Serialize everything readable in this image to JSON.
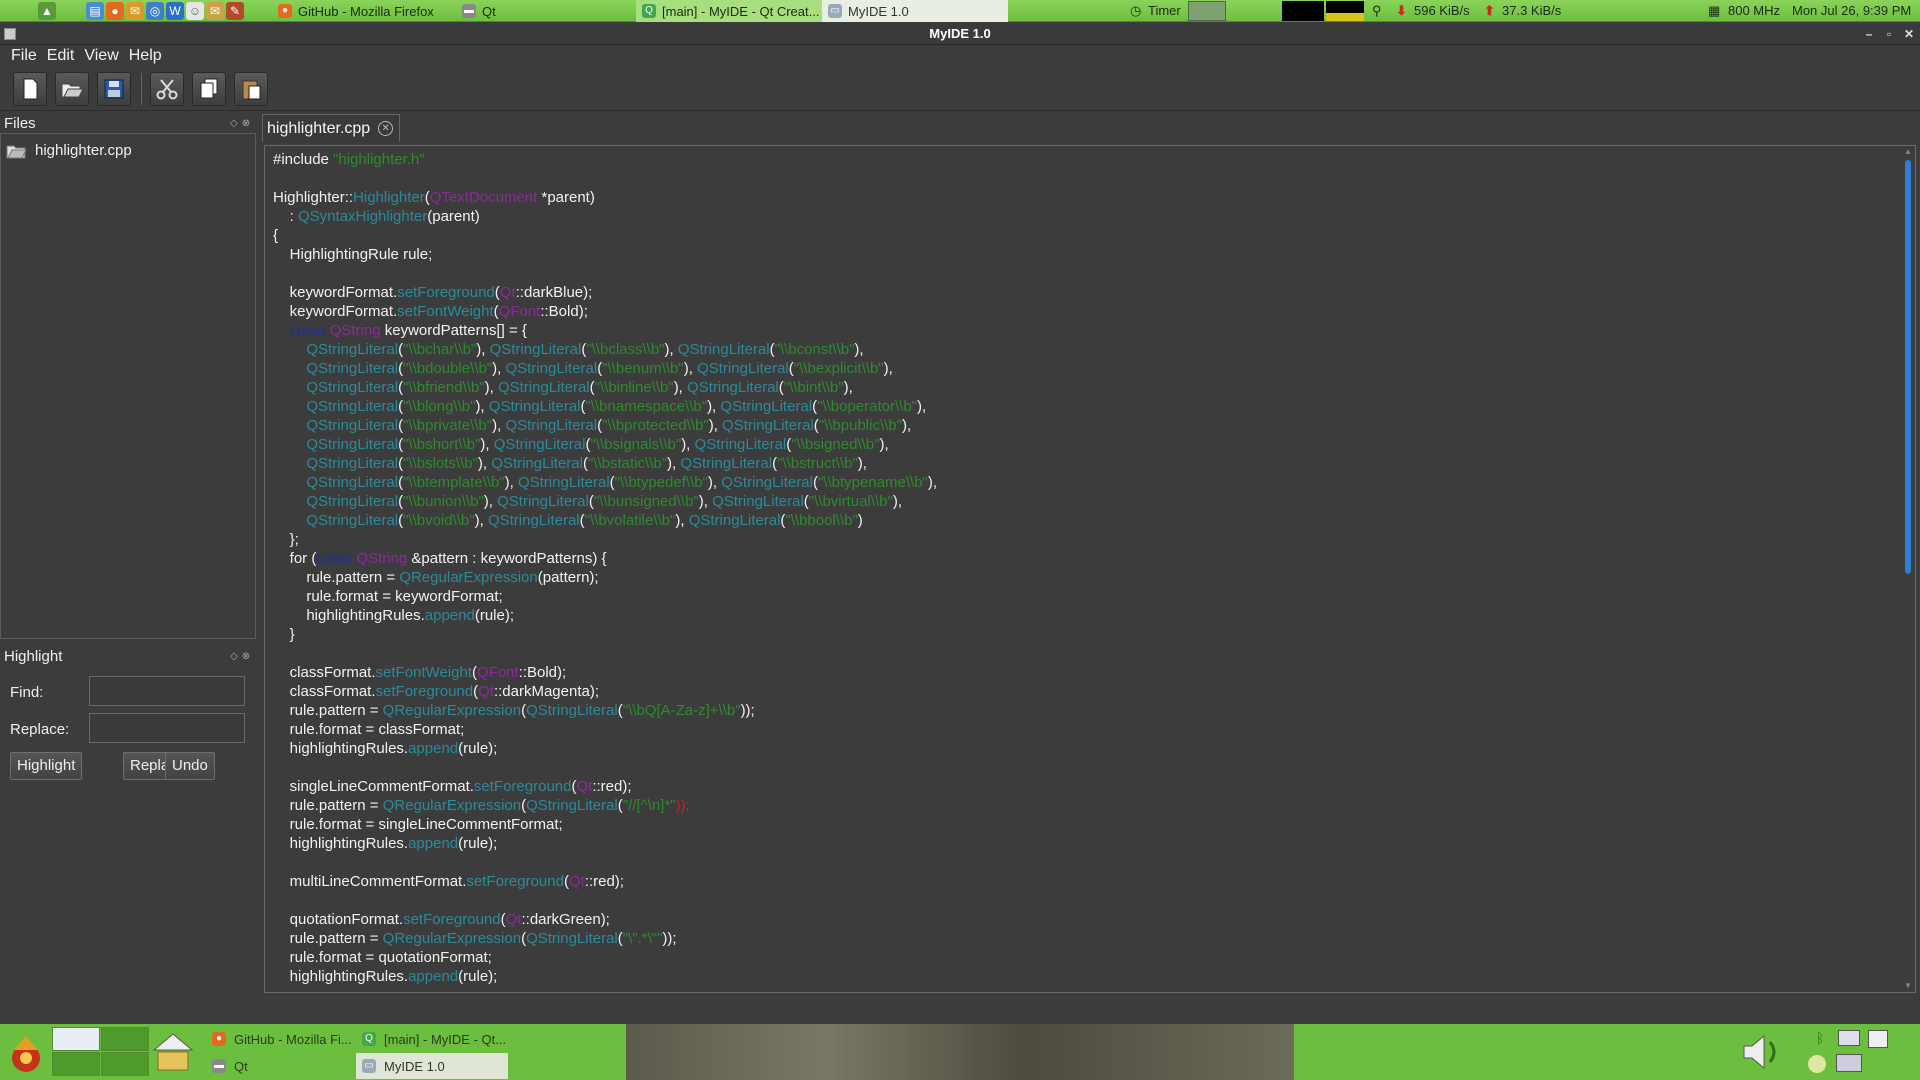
{
  "top_panel": {
    "tasks": [
      {
        "label": "GitHub - Mozilla Firefox",
        "icon": "firefox-icon"
      },
      {
        "label": "Qt",
        "icon": "folder-icon"
      },
      {
        "label": "[main] - MyIDE - Qt Creat...",
        "icon": "qtcreator-icon"
      },
      {
        "label": "MyIDE 1.0",
        "icon": "window-icon"
      }
    ],
    "timer_label": "Timer",
    "net_down": "596 KiB/s",
    "net_up": "37.3 KiB/s",
    "cpu_freq": "800 MHz",
    "clock": "Mon Jul 26,  9:39 PM"
  },
  "window": {
    "title": "MyIDE 1.0"
  },
  "menu": [
    "File",
    "Edit",
    "View",
    "Help"
  ],
  "toolbar": {
    "buttons": [
      "new-file-icon",
      "open-file-icon",
      "save-icon",
      "cut-icon",
      "copy-icon",
      "paste-icon"
    ]
  },
  "files_pane": {
    "title": "Files",
    "items": [
      "highlighter.cpp"
    ]
  },
  "highlight_pane": {
    "title": "Highlight",
    "find_label": "Find:",
    "replace_label": "Replace:",
    "find_value": "",
    "replace_value": "",
    "buttons": [
      "Highlight",
      "Replace",
      "Undo"
    ]
  },
  "editor": {
    "tab_label": "highlighter.cpp",
    "colors": {
      "default": "#f2f2f2",
      "string": "#2e8b2e",
      "type": "#8b2a9b",
      "func": "#2b8b9b",
      "keyword": "#1f2ea0",
      "red": "#d21f1f"
    },
    "lines": [
      [
        [
          "#include ",
          "default"
        ],
        [
          "\"highlighter.h\"",
          "string"
        ]
      ],
      [],
      [
        [
          "Highlighter::",
          "default"
        ],
        [
          "Highlighter",
          "func"
        ],
        [
          "(",
          "default"
        ],
        [
          "QTextDocument",
          "type"
        ],
        [
          " *parent)",
          "default"
        ]
      ],
      [
        [
          "    : ",
          "default"
        ],
        [
          "QSyntaxHighlighter",
          "func"
        ],
        [
          "(parent)",
          "default"
        ]
      ],
      [
        [
          "{",
          "default"
        ]
      ],
      [
        [
          "    HighlightingRule rule;",
          "default"
        ]
      ],
      [],
      [
        [
          "    keywordFormat.",
          "default"
        ],
        [
          "setForeground",
          "func"
        ],
        [
          "(",
          "default"
        ],
        [
          "Qt",
          "type"
        ],
        [
          "::darkBlue);",
          "default"
        ]
      ],
      [
        [
          "    keywordFormat.",
          "default"
        ],
        [
          "setFontWeight",
          "func"
        ],
        [
          "(",
          "default"
        ],
        [
          "QFont",
          "type"
        ],
        [
          "::Bold);",
          "default"
        ]
      ],
      [
        [
          "    ",
          "default"
        ],
        [
          "const",
          "keyword"
        ],
        [
          " ",
          "default"
        ],
        [
          "QString",
          "type"
        ],
        [
          " keywordPatterns[] = {",
          "default"
        ]
      ],
      [
        [
          "        ",
          "default"
        ],
        [
          "QStringLiteral",
          "func"
        ],
        [
          "(",
          "default"
        ],
        [
          "\"\\\\bchar\\\\b\"",
          "string"
        ],
        [
          "), ",
          "default"
        ],
        [
          "QStringLiteral",
          "func"
        ],
        [
          "(",
          "default"
        ],
        [
          "\"\\\\bclass\\\\b\"",
          "string"
        ],
        [
          "), ",
          "default"
        ],
        [
          "QStringLiteral",
          "func"
        ],
        [
          "(",
          "default"
        ],
        [
          "\"\\\\bconst\\\\b\"",
          "string"
        ],
        [
          "),",
          "default"
        ]
      ],
      [
        [
          "        ",
          "default"
        ],
        [
          "QStringLiteral",
          "func"
        ],
        [
          "(",
          "default"
        ],
        [
          "\"\\\\bdouble\\\\b\"",
          "string"
        ],
        [
          "), ",
          "default"
        ],
        [
          "QStringLiteral",
          "func"
        ],
        [
          "(",
          "default"
        ],
        [
          "\"\\\\benum\\\\b\"",
          "string"
        ],
        [
          "), ",
          "default"
        ],
        [
          "QStringLiteral",
          "func"
        ],
        [
          "(",
          "default"
        ],
        [
          "\"\\\\bexplicit\\\\b\"",
          "string"
        ],
        [
          "),",
          "default"
        ]
      ],
      [
        [
          "        ",
          "default"
        ],
        [
          "QStringLiteral",
          "func"
        ],
        [
          "(",
          "default"
        ],
        [
          "\"\\\\bfriend\\\\b\"",
          "string"
        ],
        [
          "), ",
          "default"
        ],
        [
          "QStringLiteral",
          "func"
        ],
        [
          "(",
          "default"
        ],
        [
          "\"\\\\binline\\\\b\"",
          "string"
        ],
        [
          "), ",
          "default"
        ],
        [
          "QStringLiteral",
          "func"
        ],
        [
          "(",
          "default"
        ],
        [
          "\"\\\\bint\\\\b\"",
          "string"
        ],
        [
          "),",
          "default"
        ]
      ],
      [
        [
          "        ",
          "default"
        ],
        [
          "QStringLiteral",
          "func"
        ],
        [
          "(",
          "default"
        ],
        [
          "\"\\\\blong\\\\b\"",
          "string"
        ],
        [
          "), ",
          "default"
        ],
        [
          "QStringLiteral",
          "func"
        ],
        [
          "(",
          "default"
        ],
        [
          "\"\\\\bnamespace\\\\b\"",
          "string"
        ],
        [
          "), ",
          "default"
        ],
        [
          "QStringLiteral",
          "func"
        ],
        [
          "(",
          "default"
        ],
        [
          "\"\\\\boperator\\\\b\"",
          "string"
        ],
        [
          "),",
          "default"
        ]
      ],
      [
        [
          "        ",
          "default"
        ],
        [
          "QStringLiteral",
          "func"
        ],
        [
          "(",
          "default"
        ],
        [
          "\"\\\\bprivate\\\\b\"",
          "string"
        ],
        [
          "), ",
          "default"
        ],
        [
          "QStringLiteral",
          "func"
        ],
        [
          "(",
          "default"
        ],
        [
          "\"\\\\bprotected\\\\b\"",
          "string"
        ],
        [
          "), ",
          "default"
        ],
        [
          "QStringLiteral",
          "func"
        ],
        [
          "(",
          "default"
        ],
        [
          "\"\\\\bpublic\\\\b\"",
          "string"
        ],
        [
          "),",
          "default"
        ]
      ],
      [
        [
          "        ",
          "default"
        ],
        [
          "QStringLiteral",
          "func"
        ],
        [
          "(",
          "default"
        ],
        [
          "\"\\\\bshort\\\\b\"",
          "string"
        ],
        [
          "), ",
          "default"
        ],
        [
          "QStringLiteral",
          "func"
        ],
        [
          "(",
          "default"
        ],
        [
          "\"\\\\bsignals\\\\b\"",
          "string"
        ],
        [
          "), ",
          "default"
        ],
        [
          "QStringLiteral",
          "func"
        ],
        [
          "(",
          "default"
        ],
        [
          "\"\\\\bsigned\\\\b\"",
          "string"
        ],
        [
          "),",
          "default"
        ]
      ],
      [
        [
          "        ",
          "default"
        ],
        [
          "QStringLiteral",
          "func"
        ],
        [
          "(",
          "default"
        ],
        [
          "\"\\\\bslots\\\\b\"",
          "string"
        ],
        [
          "), ",
          "default"
        ],
        [
          "QStringLiteral",
          "func"
        ],
        [
          "(",
          "default"
        ],
        [
          "\"\\\\bstatic\\\\b\"",
          "string"
        ],
        [
          "), ",
          "default"
        ],
        [
          "QStringLiteral",
          "func"
        ],
        [
          "(",
          "default"
        ],
        [
          "\"\\\\bstruct\\\\b\"",
          "string"
        ],
        [
          "),",
          "default"
        ]
      ],
      [
        [
          "        ",
          "default"
        ],
        [
          "QStringLiteral",
          "func"
        ],
        [
          "(",
          "default"
        ],
        [
          "\"\\\\btemplate\\\\b\"",
          "string"
        ],
        [
          "), ",
          "default"
        ],
        [
          "QStringLiteral",
          "func"
        ],
        [
          "(",
          "default"
        ],
        [
          "\"\\\\btypedef\\\\b\"",
          "string"
        ],
        [
          "), ",
          "default"
        ],
        [
          "QStringLiteral",
          "func"
        ],
        [
          "(",
          "default"
        ],
        [
          "\"\\\\btypename\\\\b\"",
          "string"
        ],
        [
          "),",
          "default"
        ]
      ],
      [
        [
          "        ",
          "default"
        ],
        [
          "QStringLiteral",
          "func"
        ],
        [
          "(",
          "default"
        ],
        [
          "\"\\\\bunion\\\\b\"",
          "string"
        ],
        [
          "), ",
          "default"
        ],
        [
          "QStringLiteral",
          "func"
        ],
        [
          "(",
          "default"
        ],
        [
          "\"\\\\bunsigned\\\\b\"",
          "string"
        ],
        [
          "), ",
          "default"
        ],
        [
          "QStringLiteral",
          "func"
        ],
        [
          "(",
          "default"
        ],
        [
          "\"\\\\bvirtual\\\\b\"",
          "string"
        ],
        [
          "),",
          "default"
        ]
      ],
      [
        [
          "        ",
          "default"
        ],
        [
          "QStringLiteral",
          "func"
        ],
        [
          "(",
          "default"
        ],
        [
          "\"\\\\bvoid\\\\b\"",
          "string"
        ],
        [
          "), ",
          "default"
        ],
        [
          "QStringLiteral",
          "func"
        ],
        [
          "(",
          "default"
        ],
        [
          "\"\\\\bvolatile\\\\b\"",
          "string"
        ],
        [
          "), ",
          "default"
        ],
        [
          "QStringLiteral",
          "func"
        ],
        [
          "(",
          "default"
        ],
        [
          "\"\\\\bbool\\\\b\"",
          "string"
        ],
        [
          ")",
          "default"
        ]
      ],
      [
        [
          "    };",
          "default"
        ]
      ],
      [
        [
          "    for (",
          "default"
        ],
        [
          "const",
          "keyword"
        ],
        [
          " ",
          "default"
        ],
        [
          "QString",
          "type"
        ],
        [
          " &pattern : keywordPatterns) {",
          "default"
        ]
      ],
      [
        [
          "        rule.pattern = ",
          "default"
        ],
        [
          "QRegularExpression",
          "func"
        ],
        [
          "(pattern);",
          "default"
        ]
      ],
      [
        [
          "        rule.format = keywordFormat;",
          "default"
        ]
      ],
      [
        [
          "        highlightingRules.",
          "default"
        ],
        [
          "append",
          "func"
        ],
        [
          "(rule);",
          "default"
        ]
      ],
      [
        [
          "    }",
          "default"
        ]
      ],
      [],
      [
        [
          "    classFormat.",
          "default"
        ],
        [
          "setFontWeight",
          "func"
        ],
        [
          "(",
          "default"
        ],
        [
          "QFont",
          "type"
        ],
        [
          "::Bold);",
          "default"
        ]
      ],
      [
        [
          "    classFormat.",
          "default"
        ],
        [
          "setForeground",
          "func"
        ],
        [
          "(",
          "default"
        ],
        [
          "Qt",
          "type"
        ],
        [
          "::darkMagenta);",
          "default"
        ]
      ],
      [
        [
          "    rule.pattern = ",
          "default"
        ],
        [
          "QRegularExpression",
          "func"
        ],
        [
          "(",
          "default"
        ],
        [
          "QStringLiteral",
          "func"
        ],
        [
          "(",
          "default"
        ],
        [
          "\"\\\\bQ[A-Za-z]+\\\\b\"",
          "string"
        ],
        [
          "));",
          "default"
        ]
      ],
      [
        [
          "    rule.format = classFormat;",
          "default"
        ]
      ],
      [
        [
          "    highlightingRules.",
          "default"
        ],
        [
          "append",
          "func"
        ],
        [
          "(rule);",
          "default"
        ]
      ],
      [],
      [
        [
          "    singleLineCommentFormat.",
          "default"
        ],
        [
          "setForeground",
          "func"
        ],
        [
          "(",
          "default"
        ],
        [
          "Qt",
          "type"
        ],
        [
          "::red);",
          "default"
        ]
      ],
      [
        [
          "    rule.pattern = ",
          "default"
        ],
        [
          "QRegularExpression",
          "func"
        ],
        [
          "(",
          "default"
        ],
        [
          "QStringLiteral",
          "func"
        ],
        [
          "(",
          "default"
        ],
        [
          "\"//[^\\n]*\"",
          "string"
        ],
        [
          "));",
          "red"
        ]
      ],
      [
        [
          "    rule.format = singleLineCommentFormat;",
          "default"
        ]
      ],
      [
        [
          "    highlightingRules.",
          "default"
        ],
        [
          "append",
          "func"
        ],
        [
          "(rule);",
          "default"
        ]
      ],
      [],
      [
        [
          "    multiLineCommentFormat.",
          "default"
        ],
        [
          "setForeground",
          "func"
        ],
        [
          "(",
          "default"
        ],
        [
          "Qt",
          "type"
        ],
        [
          "::red);",
          "default"
        ]
      ],
      [],
      [
        [
          "    quotationFormat.",
          "default"
        ],
        [
          "setForeground",
          "func"
        ],
        [
          "(",
          "default"
        ],
        [
          "Qt",
          "type"
        ],
        [
          "::darkGreen);",
          "default"
        ]
      ],
      [
        [
          "    rule.pattern = ",
          "default"
        ],
        [
          "QRegularExpression",
          "func"
        ],
        [
          "(",
          "default"
        ],
        [
          "QStringLiteral",
          "func"
        ],
        [
          "(",
          "default"
        ],
        [
          "\"\\\".*\\\"\"",
          "string"
        ],
        [
          "));",
          "default"
        ]
      ],
      [
        [
          "    rule.format = quotationFormat;",
          "default"
        ]
      ],
      [
        [
          "    highlightingRules.",
          "default"
        ],
        [
          "append",
          "func"
        ],
        [
          "(rule);",
          "default"
        ]
      ]
    ]
  },
  "bottom_panel": {
    "tasks": [
      {
        "label": "GitHub - Mozilla Fi...",
        "icon": "firefox-icon"
      },
      {
        "label": "[main] - MyIDE - Qt...",
        "icon": "qtcreator-icon"
      },
      {
        "label": "Qt",
        "icon": "folder-icon"
      },
      {
        "label": "MyIDE 1.0",
        "icon": "window-icon"
      }
    ]
  }
}
